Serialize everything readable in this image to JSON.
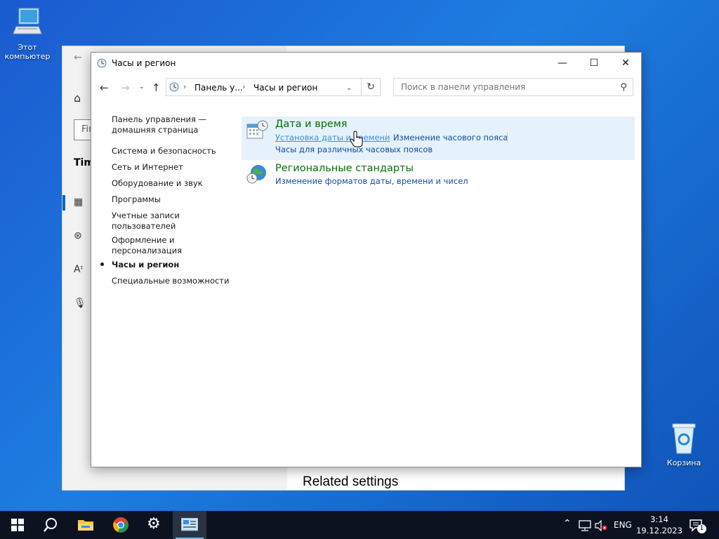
{
  "desktop": {
    "this_pc_label": "Этот компьютер",
    "recycle_bin_label": "Корзина"
  },
  "settings_window": {
    "find_placeholder": "Fin",
    "section_title": "Tim",
    "related_settings": "Related settings"
  },
  "control_panel": {
    "title": "Часы и регион",
    "breadcrumbs": [
      "Панель у...",
      "Часы и регион"
    ],
    "search_placeholder": "Поиск в панели управления",
    "left_nav": [
      {
        "label": "Панель управления —\nдомашняя страница",
        "active": false
      },
      {
        "label": "Система и безопасность",
        "active": false
      },
      {
        "label": "Сеть и Интернет",
        "active": false
      },
      {
        "label": "Оборудование и звук",
        "active": false
      },
      {
        "label": "Программы",
        "active": false
      },
      {
        "label": "Учетные записи\nпользователей",
        "active": false
      },
      {
        "label": "Оформление и\nперсонализация",
        "active": false
      },
      {
        "label": "Часы и регион",
        "active": true
      },
      {
        "label": "Специальные возможности",
        "active": false
      }
    ],
    "categories": [
      {
        "title": "Дата и время",
        "links": [
          "Установка даты и времени",
          "Изменение часового пояса",
          "Часы для различных часовых поясов"
        ],
        "icon": "calendar-clock-icon",
        "highlighted": true
      },
      {
        "title": "Региональные стандарты",
        "links": [
          "Изменение форматов даты, времени и чисел"
        ],
        "icon": "globe-clock-icon",
        "highlighted": false
      }
    ]
  },
  "taskbar": {
    "language": "ENG",
    "time": "3:14",
    "date": "19.12.2023",
    "notification_count": "1"
  },
  "colors": {
    "link": "#0f4c9f",
    "category_title": "#007200",
    "highlight": "#e5f1fb",
    "taskbar": "#0c1220"
  }
}
